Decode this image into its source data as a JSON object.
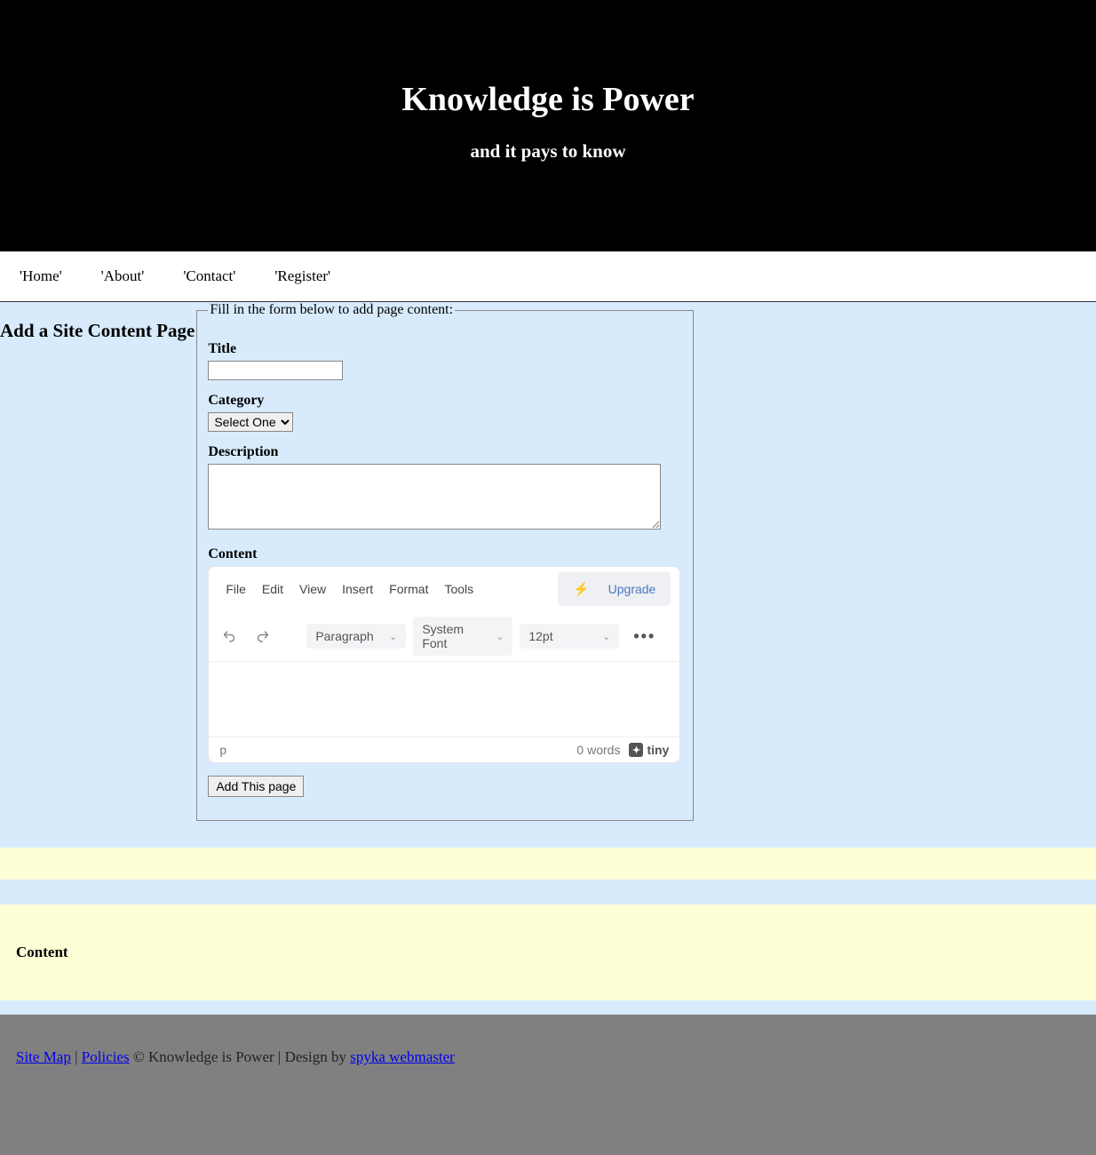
{
  "header": {
    "title": "Knowledge is Power",
    "subtitle": "and it pays to know"
  },
  "nav": {
    "items": [
      "'Home'",
      "'About'",
      "'Contact'",
      "'Register'"
    ]
  },
  "page_title": "Add a Site Content Page",
  "form": {
    "legend": "Fill in the form below to add page content:",
    "title_label": "Title",
    "title_value": "",
    "category_label": "Category",
    "category_selected": "Select One",
    "description_label": "Description",
    "description_value": "",
    "content_label": "Content",
    "submit_label": "Add This page"
  },
  "editor": {
    "menus": [
      "File",
      "Edit",
      "View",
      "Insert",
      "Format",
      "Tools"
    ],
    "upgrade": "Upgrade",
    "block": "Paragraph",
    "font": "System Font",
    "size": "12pt",
    "path": "p",
    "words": "0 words",
    "brand": "tiny"
  },
  "sidebar": {
    "content_heading": "Content"
  },
  "footer": {
    "sitemap": "Site Map",
    "policies": "Policies",
    "sep1": " | ",
    "copyright": "   © Knowledge is Power | Design by ",
    "designer": "spyka webmaster"
  }
}
